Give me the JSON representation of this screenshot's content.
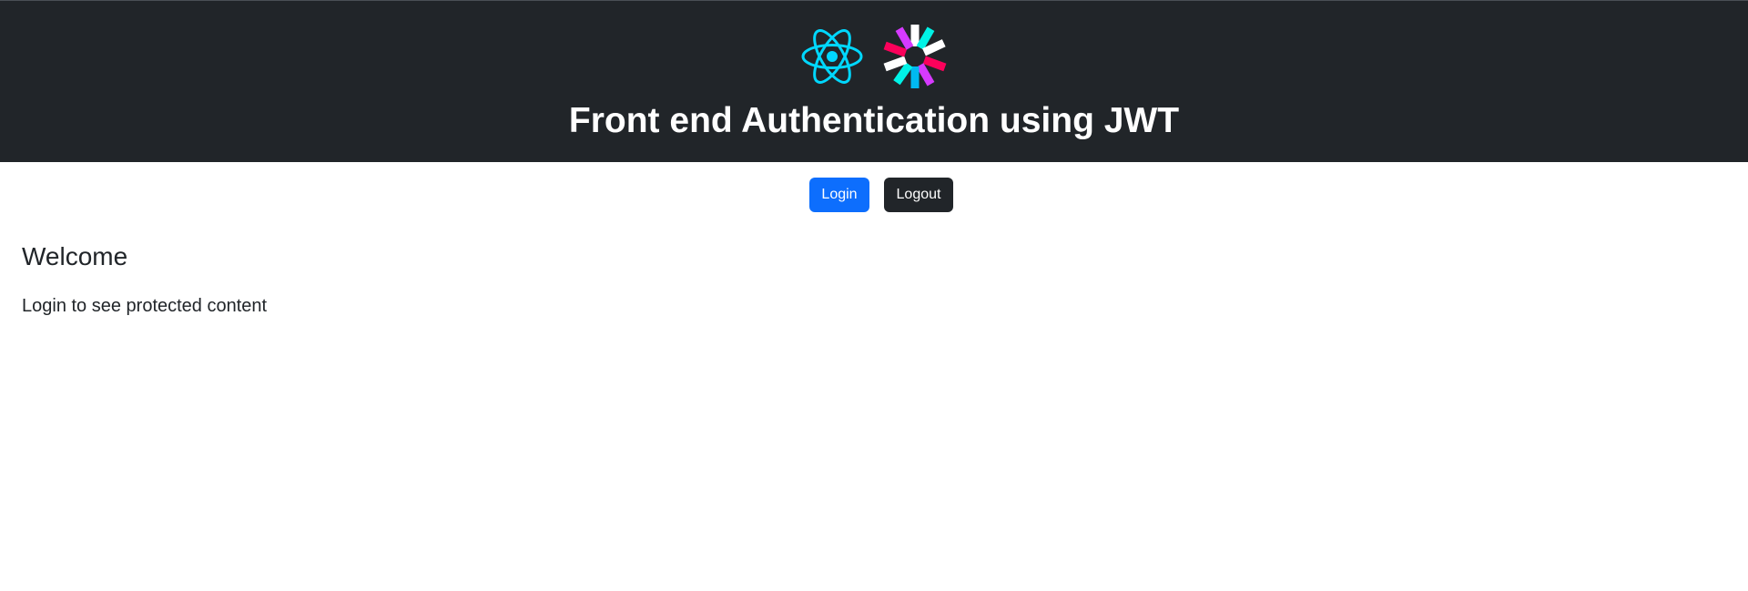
{
  "header": {
    "title": "Front end Authentication using JWT",
    "background_color": "#212529",
    "logos": [
      {
        "icon": "react-icon",
        "color": "#00d8ff"
      },
      {
        "icon": "jwt-icon",
        "colors": [
          "#00b9f1",
          "#d63aff",
          "#fb015b",
          "#ffffff"
        ]
      }
    ]
  },
  "actions": {
    "login_label": "Login",
    "logout_label": "Logout",
    "login_color": "#0d6efd",
    "logout_color": "#212529"
  },
  "main": {
    "heading": "Welcome",
    "message": "Login to see protected content"
  }
}
